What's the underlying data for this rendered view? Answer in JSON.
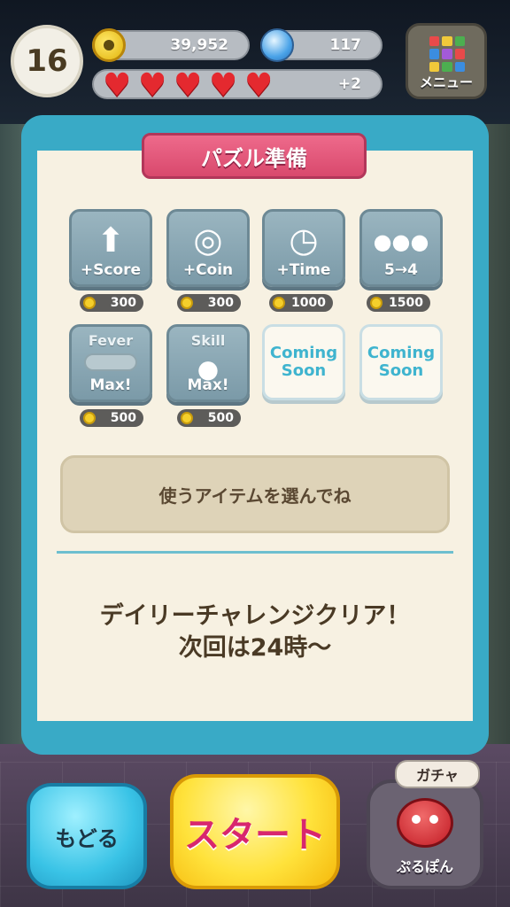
{
  "header": {
    "level": "16",
    "coins": "39,952",
    "gems": "117",
    "hearts_count": 5,
    "hearts_extra": "+2",
    "menu_label": "メニュー"
  },
  "panel": {
    "title": "パズル準備",
    "items": [
      {
        "label": "+Score",
        "price": "300",
        "icon": "arrow-up-icon"
      },
      {
        "label": "+Coin",
        "price": "300",
        "icon": "coin-disc-icon"
      },
      {
        "label": "+Time",
        "price": "1000",
        "icon": "clock-icon"
      },
      {
        "label": "5→4",
        "price": "1500",
        "icon": "puyo-group-icon"
      },
      {
        "top": "Fever",
        "label": "Max!",
        "price": "500",
        "icon": "fever-gauge-icon"
      },
      {
        "top": "Skill",
        "label": "Max!",
        "price": "500",
        "icon": "skill-puyo-icon"
      }
    ],
    "coming_soon": [
      "Coming\nSoon",
      "Coming\nSoon"
    ],
    "hint": "使うアイテムを選んでね",
    "daily_line1": "デイリーチャレンジクリア！",
    "daily_line2": "次回は24時〜"
  },
  "bottom": {
    "back_label": "もどる",
    "start_label": "スタート",
    "gacha_tag": "ガチャ",
    "gacha_label": "ぷるぽん"
  }
}
